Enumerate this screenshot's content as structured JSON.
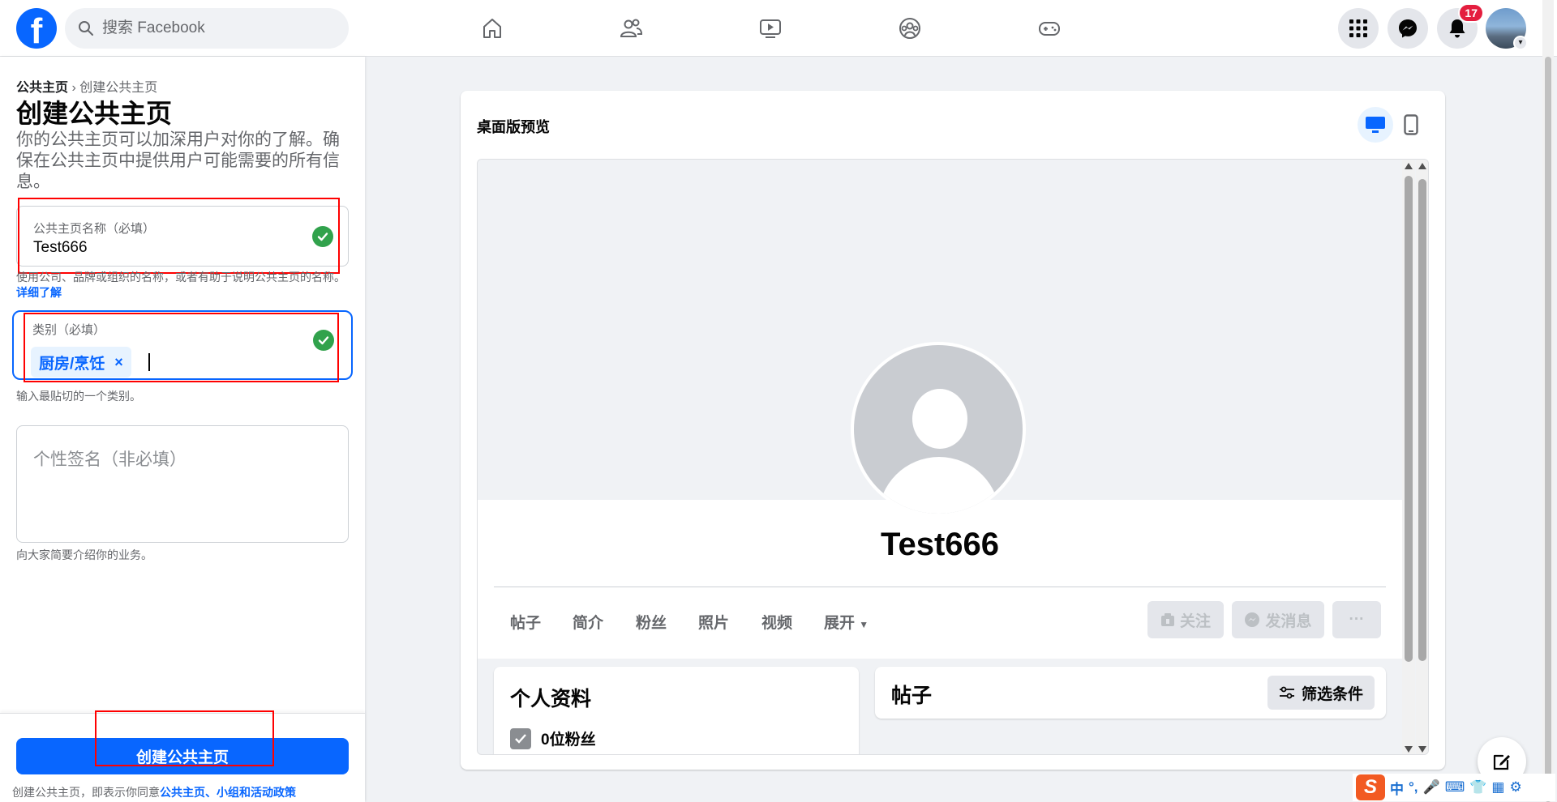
{
  "colors": {
    "brand": "#0866ff",
    "success": "#31a24c",
    "badge": "#e41e3f",
    "annotation": "#ff0000"
  },
  "topbar": {
    "logo": "f",
    "search": {
      "placeholder": "搜索 Facebook"
    },
    "nav_icons": [
      "home-icon",
      "friends-icon",
      "watch-icon",
      "groups-icon",
      "gaming-icon"
    ],
    "notifications_count": "17"
  },
  "left_panel": {
    "breadcrumb": {
      "root": "公共主页",
      "separator": " › ",
      "current": "创建公共主页"
    },
    "title": "创建公共主页",
    "description": "你的公共主页可以加深用户对你的了解。确保在公共主页中提供用户可能需要的所有信息。",
    "page_name_field": {
      "label": "公共主页名称（必填）",
      "value": "Test666"
    },
    "page_name_help": "使用公司、品牌或组织的名称，或者有助于说明公共主页的名称。",
    "page_name_help_link": "详细了解",
    "category_field": {
      "label": "类别（必填）",
      "chip": "厨房/烹饪",
      "chip_remove": "×"
    },
    "category_help": "输入最贴切的一个类别。",
    "bio_field": {
      "placeholder": "个性签名（非必填）"
    },
    "bio_help": "向大家简要介绍你的业务。",
    "create_button": "创建公共主页",
    "terms_prefix": "创建公共主页，即表示你同意",
    "terms_link": "公共主页、小组和活动政策"
  },
  "preview": {
    "title": "桌面版预览",
    "profile_name": "Test666",
    "tabs": [
      "帖子",
      "简介",
      "粉丝",
      "照片",
      "视频",
      "展开"
    ],
    "follow_button": "关注",
    "message_button": "发消息",
    "more_button": "···",
    "intro_title": "个人资料",
    "fans": "0位粉丝",
    "posts_title": "帖子",
    "filter_button": "筛选条件"
  },
  "ime": {
    "logo": "S",
    "mode": "中",
    "punct": "°,"
  }
}
